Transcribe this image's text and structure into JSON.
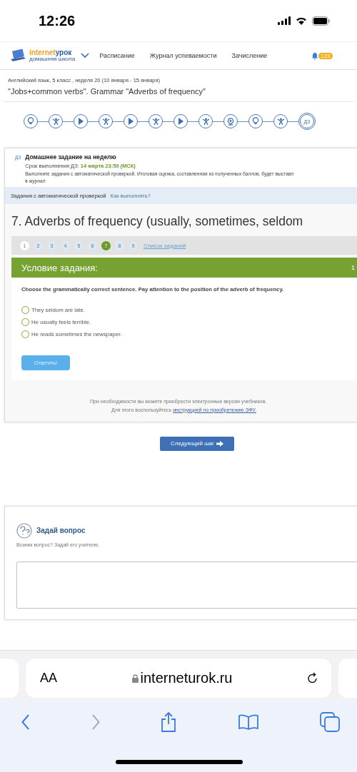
{
  "status_bar": {
    "time": "12:26"
  },
  "header": {
    "logo": {
      "brand_a": "internet",
      "brand_b": "урок",
      "tagline": "домашняя школа"
    },
    "nav": [
      "Расписание",
      "Журнал успеваемости",
      "Зачисление"
    ],
    "badge": "123"
  },
  "lesson": {
    "breadcrumb": "Английский язык, 5 класс , неделя 20 (10 января - 15 января)",
    "title": "\"Jobs+common verbs\". Grammar \"Adverbs of frequency\""
  },
  "steps": [
    {
      "kind": "bulb",
      "selected": false
    },
    {
      "kind": "exercise",
      "selected": false
    },
    {
      "kind": "video",
      "selected": false
    },
    {
      "kind": "exercise",
      "selected": false
    },
    {
      "kind": "video",
      "selected": false
    },
    {
      "kind": "exercise",
      "selected": false
    },
    {
      "kind": "video",
      "selected": false
    },
    {
      "kind": "exercise",
      "selected": false
    },
    {
      "kind": "webcam",
      "selected": false
    },
    {
      "kind": "bulb",
      "selected": false
    },
    {
      "kind": "exercise",
      "selected": false
    },
    {
      "kind": "homework",
      "label": "ДЗ",
      "selected": true
    }
  ],
  "homework": {
    "tag": "ДЗ",
    "title": "Домашнее задание на неделю",
    "deadline_label": "Срок выполнения ДЗ:",
    "deadline": "14 марта 23:59 (МСК)",
    "text_lines": [
      "Выполните задания с автоматической проверкой. Итоговая оценка, составленная из полученных баллов, будет выставл",
      "в журнал"
    ]
  },
  "tasks_bar": {
    "label": "Задания с автоматической проверкой",
    "link": "Как выполнять?"
  },
  "task": {
    "title": "7. Adverbs of frequency (usually, sometimes, seldom",
    "pages": [
      {
        "label": "1",
        "viewed": true,
        "selected": false
      },
      {
        "label": "2",
        "viewed": false,
        "selected": false
      },
      {
        "label": "3",
        "viewed": false,
        "selected": false
      },
      {
        "label": "4",
        "viewed": false,
        "selected": false
      },
      {
        "label": "5",
        "viewed": false,
        "selected": false
      },
      {
        "label": "6",
        "viewed": false,
        "selected": false
      },
      {
        "label": "7",
        "viewed": false,
        "selected": true
      },
      {
        "label": "8",
        "viewed": false,
        "selected": false
      },
      {
        "label": "9",
        "viewed": false,
        "selected": false
      }
    ],
    "task_list_link": "Список заданий",
    "condition_title": "Условие задания:",
    "points": "1",
    "question": "Choose the grammatically correct sentence. Pay attention to the position of the adverb of frequency.",
    "options": [
      {
        "text": "They seldom are late.",
        "selected": false
      },
      {
        "text": "He usually feels terrible.",
        "selected": false
      },
      {
        "text": "He reads sometimes the newspaper.",
        "selected": false
      }
    ],
    "answer_button": "Ответить!",
    "note_line1": "При необходимости вы можете приобрести электронные версии учебников.",
    "note_prefix": "Для этого воспользуйтесь",
    "note_link": "инструкцией по приобретению ЭФУ."
  },
  "next_button": "Следующий шаг",
  "ask": {
    "title": "Задай вопрос",
    "subtitle": "Возник вопрос? Задай его учителю."
  },
  "browser": {
    "text_size": "AA",
    "url": "interneturok.ru"
  }
}
